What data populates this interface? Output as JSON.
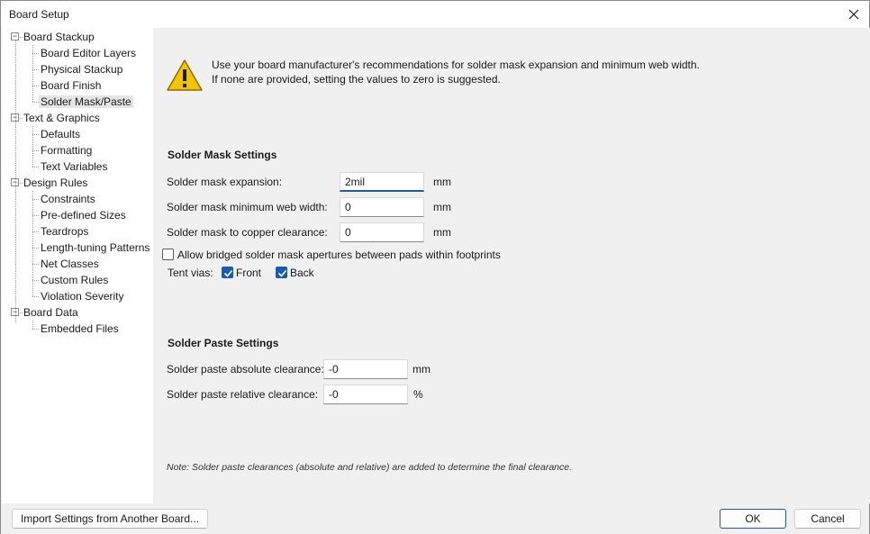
{
  "window": {
    "title": "Board Setup"
  },
  "tree": {
    "groups": [
      {
        "label": "Board Stackup",
        "expander": "⊟",
        "children": [
          "Board Editor Layers",
          "Physical Stackup",
          "Board Finish",
          "Solder Mask/Paste"
        ]
      },
      {
        "label": "Text & Graphics",
        "expander": "⊟",
        "children": [
          "Defaults",
          "Formatting",
          "Text Variables"
        ]
      },
      {
        "label": "Design Rules",
        "expander": "⊟",
        "children": [
          "Constraints",
          "Pre-defined Sizes",
          "Teardrops",
          "Length-tuning Patterns",
          "Net Classes",
          "Custom Rules",
          "Violation Severity"
        ]
      },
      {
        "label": "Board Data",
        "expander": "⊟",
        "children": [
          "Embedded Files"
        ]
      }
    ],
    "selected": "Solder Mask/Paste"
  },
  "warning": {
    "line1": "Use your board manufacturer's recommendations for solder mask expansion and minimum web width.",
    "line2": "If none are provided, setting the values to zero is suggested."
  },
  "solder_mask": {
    "title": "Solder Mask Settings",
    "expansion_label": "Solder mask expansion:",
    "expansion_value": "2mil",
    "expansion_unit": "mm",
    "web_width_label": "Solder mask minimum web width:",
    "web_width_value": "0",
    "web_width_unit": "mm",
    "copper_clearance_label": "Solder mask to copper clearance:",
    "copper_clearance_value": "0",
    "copper_clearance_unit": "mm",
    "allow_bridged_label": "Allow bridged solder mask apertures between pads within footprints",
    "allow_bridged_checked": false,
    "tent_vias_label": "Tent vias:",
    "front_label": "Front",
    "front_checked": true,
    "back_label": "Back",
    "back_checked": true
  },
  "solder_paste": {
    "title": "Solder Paste Settings",
    "absolute_label": "Solder paste absolute clearance:",
    "absolute_value": "-0",
    "absolute_unit": "mm",
    "relative_label": "Solder paste relative clearance:",
    "relative_value": "-0",
    "relative_unit": "%"
  },
  "note": "Note: Solder paste clearances (absolute and relative) are added to determine the final clearance.",
  "buttons": {
    "import": "Import Settings from Another Board...",
    "ok": "OK",
    "cancel": "Cancel"
  },
  "colors": {
    "accent": "#1e5aa8",
    "warning_yellow": "#f5c400"
  }
}
